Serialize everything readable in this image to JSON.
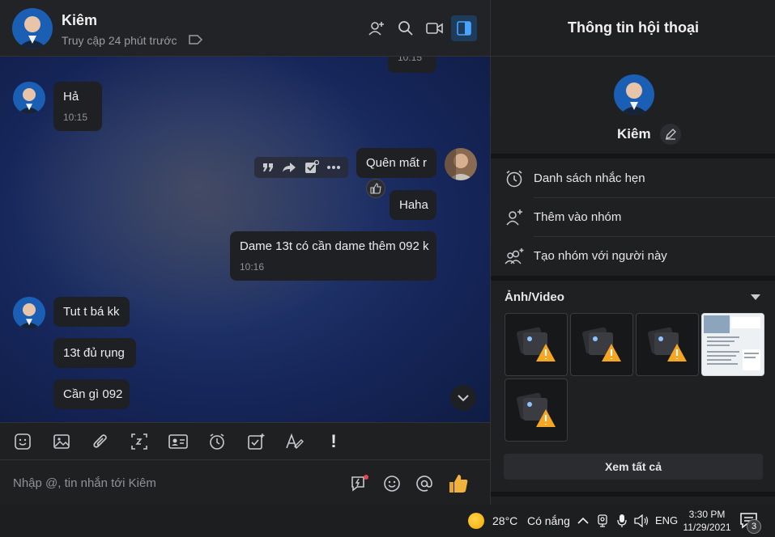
{
  "colors": {
    "accent": "#1d3b5a",
    "panel": "#1f2022",
    "bubble": "#1e2023",
    "warning": "#f5a623"
  },
  "header": {
    "contact_name": "Kiêm",
    "status": "Truy cập 24 phút trước",
    "icons": [
      "add-friend-icon",
      "search-icon",
      "video-call-icon",
      "toggle-panel-icon"
    ]
  },
  "messages": {
    "clipped_time": "10:15",
    "m1": {
      "text": "Hả",
      "time": "10:15"
    },
    "m2": {
      "text": "Quên mất r"
    },
    "m3": {
      "text": "Haha"
    },
    "m4": {
      "text": "Dame 13t có cần dame thêm 092 k",
      "time": "10:16"
    },
    "m5": {
      "text": "Tut t bá kk"
    },
    "m6": {
      "text": "13t đủ rụng"
    },
    "m7": {
      "text": "Cần gì 092"
    }
  },
  "toolbar": {
    "icons": [
      "sticker-icon",
      "image-icon",
      "attachment-icon",
      "screenshot-icon",
      "contact-card-icon",
      "reminder-icon",
      "task-icon",
      "format-text-icon",
      "urgent-icon"
    ],
    "urgent_label": "!"
  },
  "composer": {
    "placeholder": "Nhập @, tin nhắn tới Kiêm",
    "icons": [
      "quick-message-icon",
      "emoji-icon",
      "mention-icon",
      "like-icon"
    ]
  },
  "info_panel": {
    "title": "Thông tin hội thoại",
    "name": "Kiêm",
    "menu": [
      {
        "label": "Danh sách nhắc hẹn",
        "icon": "alarm-icon"
      },
      {
        "label": "Thêm vào nhóm",
        "icon": "add-to-group-icon"
      },
      {
        "label": "Tạo nhóm với người này",
        "icon": "create-group-icon"
      }
    ],
    "media_title": "Ảnh/Video",
    "see_all": "Xem tất cả"
  },
  "taskbar": {
    "temperature": "28°C",
    "weather": "Có nắng",
    "language": "ENG",
    "time": "3:30 PM",
    "date": "11/29/2021",
    "notifications": "3"
  }
}
